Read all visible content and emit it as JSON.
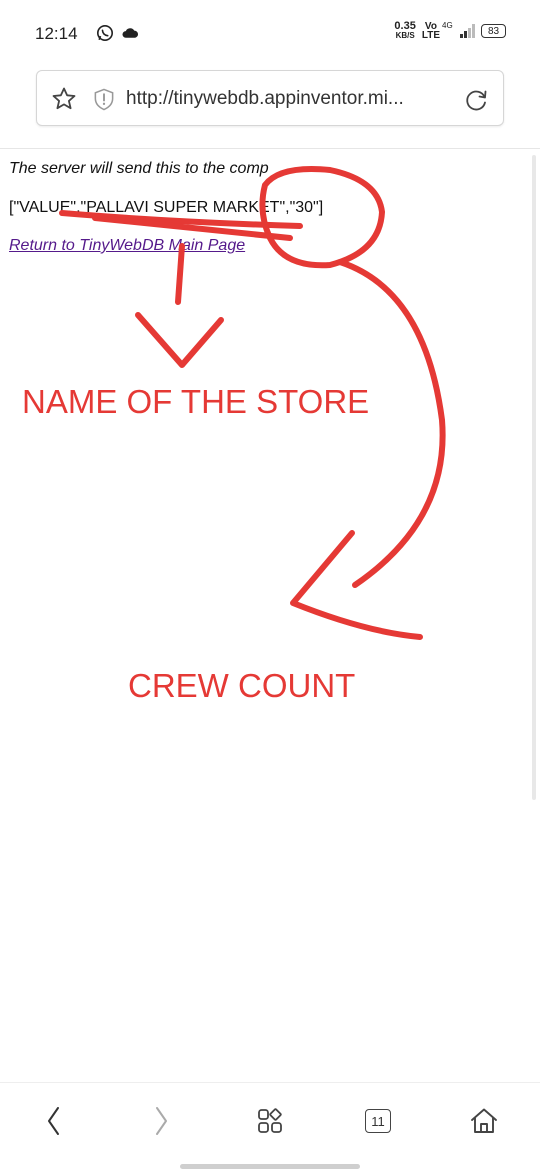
{
  "status_bar": {
    "time": "12:14",
    "net_speed_value": "0.35",
    "net_speed_unit": "KB/S",
    "volte_top": "Vo",
    "volte_bottom": "LTE",
    "network_type": "4G",
    "battery": "83"
  },
  "browser": {
    "url": "http://tinywebdb.appinventor.mi..."
  },
  "page": {
    "line1": "The server will send this to the comp",
    "line2": "[\"VALUE\",\"PALLAVI SUPER MARKET\",\"30\"]",
    "link_text": "Return to TinyWebDB Main Page"
  },
  "annotations": {
    "store_label": "NAME OF THE STORE",
    "crew_label": "CREW COUNT",
    "color": "#e53935"
  },
  "bottom_nav": {
    "tab_count": "11"
  },
  "icons": [
    "whatsapp-icon",
    "cloud-icon",
    "star-icon",
    "shield-icon",
    "reload-icon",
    "back-icon",
    "forward-icon",
    "menu-icon",
    "tabs-icon",
    "home-icon"
  ]
}
